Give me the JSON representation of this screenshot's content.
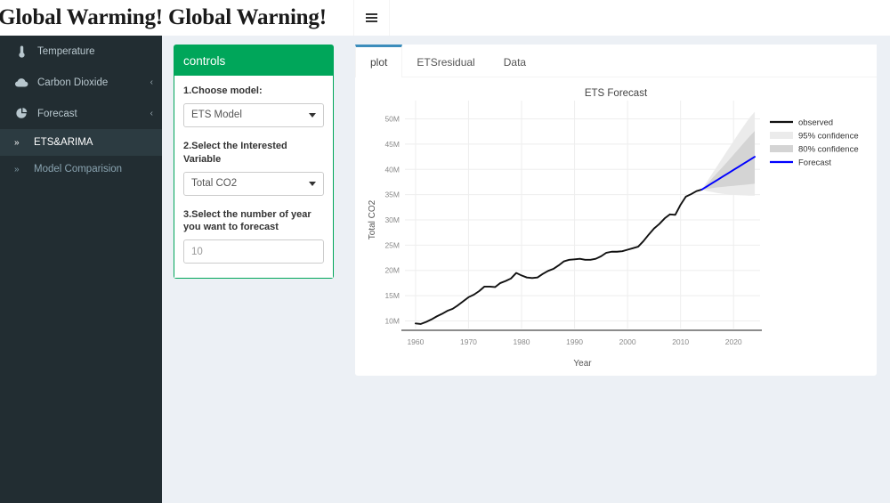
{
  "header": {
    "title": "Global Warming! Global Warning!",
    "menu_icon": "hamburger-icon"
  },
  "sidebar": {
    "items": [
      {
        "label": "Temperature",
        "icon": "thermometer-icon",
        "arrow": "",
        "has_arrow": false
      },
      {
        "label": "Carbon Dioxide",
        "icon": "cloud-icon",
        "arrow": "‹",
        "has_arrow": true
      },
      {
        "label": "Forecast",
        "icon": "pie-chart-icon",
        "arrow": "‹",
        "has_arrow": true
      }
    ],
    "subitems": [
      {
        "label": "ETS&ARIMA",
        "chevron": "»",
        "active": true
      },
      {
        "label": "Model Comparision",
        "chevron": "»",
        "active": false
      }
    ]
  },
  "controls": {
    "title": "controls",
    "model": {
      "label": "1.Choose model:",
      "value": "ETS Model",
      "options": [
        "ETS Model"
      ]
    },
    "variable": {
      "label": "2.Select the Interested Variable",
      "value": "Total CO2",
      "options": [
        "Total CO2"
      ]
    },
    "years": {
      "label": "3.Select the number of year you want to forecast",
      "value": "10",
      "placeholder": "10"
    }
  },
  "tabs": [
    {
      "label": "plot",
      "active": true
    },
    {
      "label": "ETSresidual",
      "active": false
    },
    {
      "label": "Data",
      "active": false
    }
  ],
  "colors": {
    "accent_green": "#00a65a",
    "tab_blue": "#3c8dbc",
    "sidebar_bg": "#222d32",
    "page_bg": "#ecf0f5",
    "forecast_blue": "#0000ff",
    "observed_black": "#111111",
    "ci95": "#ebebeb",
    "ci80": "#d4d4d4"
  },
  "chart_data": {
    "type": "line",
    "title": "ETS Forecast",
    "xlabel": "Year",
    "ylabel": "Total CO2",
    "xlim": [
      1958,
      2025
    ],
    "ylim": [
      8500000,
      51500000
    ],
    "xticks": [
      1960,
      1970,
      1980,
      1990,
      2000,
      2010,
      2020
    ],
    "yticks": [
      10000000,
      15000000,
      20000000,
      25000000,
      30000000,
      35000000,
      40000000,
      45000000,
      50000000
    ],
    "ytick_labels": [
      "10M",
      "15M",
      "20M",
      "25M",
      "30M",
      "35M",
      "40M",
      "45M",
      "50M"
    ],
    "grid": true,
    "legend_position": "right",
    "legend": [
      {
        "name": "observed",
        "type": "line",
        "color": "#111111"
      },
      {
        "name": "95% confidence",
        "type": "band",
        "color": "#ebebeb"
      },
      {
        "name": "80% confidence",
        "type": "band",
        "color": "#d4d4d4"
      },
      {
        "name": "Forecast",
        "type": "line",
        "color": "#0000ff"
      }
    ],
    "series": [
      {
        "name": "observed",
        "color": "#111111",
        "x": [
          1960,
          1961,
          1962,
          1963,
          1964,
          1965,
          1966,
          1967,
          1968,
          1969,
          1970,
          1971,
          1972,
          1973,
          1974,
          1975,
          1976,
          1977,
          1978,
          1979,
          1980,
          1981,
          1982,
          1983,
          1984,
          1985,
          1986,
          1987,
          1988,
          1989,
          1990,
          1991,
          1992,
          1993,
          1994,
          1995,
          1996,
          1997,
          1998,
          1999,
          2000,
          2001,
          2002,
          2003,
          2004,
          2005,
          2006,
          2007,
          2008,
          2009,
          2010,
          2011,
          2012,
          2013,
          2014
        ],
        "y": [
          9500000,
          9400000,
          9800000,
          10300000,
          10900000,
          11400000,
          12000000,
          12400000,
          13100000,
          13900000,
          14700000,
          15200000,
          15900000,
          16800000,
          16800000,
          16700000,
          17500000,
          17900000,
          18400000,
          19500000,
          19000000,
          18600000,
          18500000,
          18600000,
          19300000,
          19900000,
          20300000,
          21000000,
          21800000,
          22100000,
          22200000,
          22300000,
          22100000,
          22100000,
          22300000,
          22800000,
          23500000,
          23700000,
          23700000,
          23800000,
          24100000,
          24400000,
          24700000,
          25800000,
          27100000,
          28300000,
          29200000,
          30300000,
          31100000,
          31000000,
          33000000,
          34600000,
          35100000,
          35700000,
          36000000
        ]
      },
      {
        "name": "Forecast",
        "color": "#0000ff",
        "x": [
          2014,
          2015,
          2016,
          2017,
          2018,
          2019,
          2020,
          2021,
          2022,
          2023,
          2024
        ],
        "y": [
          36000000,
          36650000,
          37300000,
          37950000,
          38600000,
          39250000,
          39900000,
          40550000,
          41200000,
          41850000,
          42500000
        ]
      }
    ],
    "bands": [
      {
        "name": "95% confidence",
        "color": "#ebebeb",
        "x": [
          2014,
          2015,
          2016,
          2017,
          2018,
          2019,
          2020,
          2021,
          2022,
          2023,
          2024
        ],
        "upper": [
          36000000,
          37600000,
          39200000,
          40800000,
          42400000,
          44000000,
          45600000,
          47200000,
          48700000,
          50200000,
          51400000
        ],
        "lower": [
          36000000,
          35700000,
          35500000,
          35300000,
          35150000,
          35050000,
          34950000,
          34900000,
          34850000,
          34800000,
          34800000
        ]
      },
      {
        "name": "80% confidence",
        "color": "#d4d4d4",
        "x": [
          2014,
          2015,
          2016,
          2017,
          2018,
          2019,
          2020,
          2021,
          2022,
          2023,
          2024
        ],
        "upper": [
          36000000,
          37100000,
          38250000,
          39400000,
          40550000,
          41700000,
          42900000,
          44100000,
          45300000,
          46500000,
          47600000
        ],
        "lower": [
          36000000,
          36150000,
          36300000,
          36450000,
          36550000,
          36650000,
          36750000,
          36850000,
          36950000,
          37050000,
          37150000
        ]
      }
    ]
  }
}
